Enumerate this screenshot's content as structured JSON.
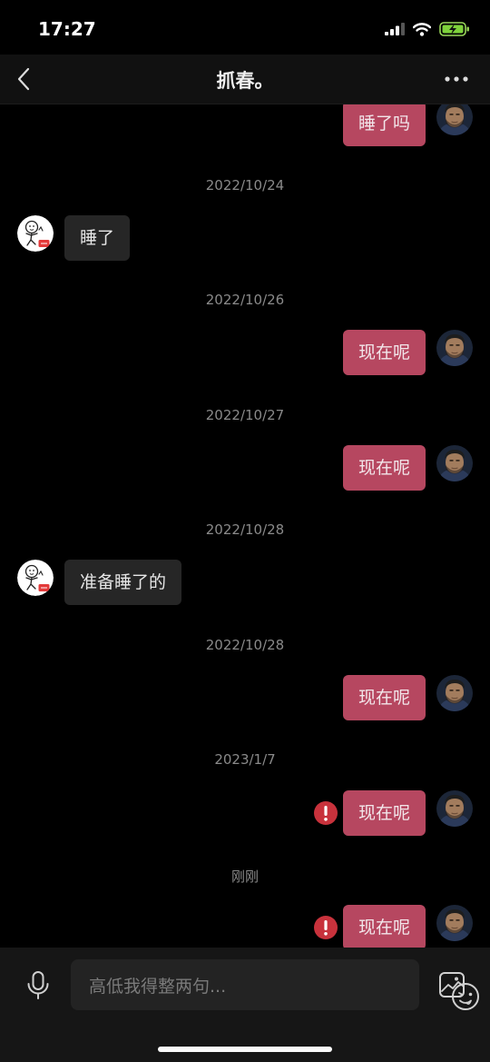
{
  "status": {
    "time": "17:27"
  },
  "header": {
    "title": "抓春。"
  },
  "messages": [
    {
      "text": "睡了吗",
      "side": "me"
    },
    {
      "timestamp": "2022/10/24"
    },
    {
      "text": "睡了",
      "side": "them"
    },
    {
      "timestamp": "2022/10/26"
    },
    {
      "text": "现在呢",
      "side": "me"
    },
    {
      "timestamp": "2022/10/27"
    },
    {
      "text": "现在呢",
      "side": "me"
    },
    {
      "timestamp": "2022/10/28"
    },
    {
      "text": "准备睡了的",
      "side": "them"
    },
    {
      "timestamp": "2022/10/28"
    },
    {
      "text": "现在呢",
      "side": "me"
    },
    {
      "timestamp": "2023/1/7"
    },
    {
      "text": "现在呢",
      "side": "me",
      "failed": true
    },
    {
      "timestamp": "刚刚"
    },
    {
      "text": "现在呢",
      "side": "me",
      "failed": true
    }
  ],
  "input": {
    "placeholder": "高低我得整两句..."
  },
  "colors": {
    "my_bubble": "#b64760",
    "their_bubble": "#262626",
    "error": "#c8323c"
  },
  "icons": {
    "back": "chevron-left-icon",
    "more": "more-dots-icon",
    "voice": "microphone-icon",
    "emoji": "emoji-icon",
    "image": "image-icon",
    "failed": "exclamation-icon"
  }
}
